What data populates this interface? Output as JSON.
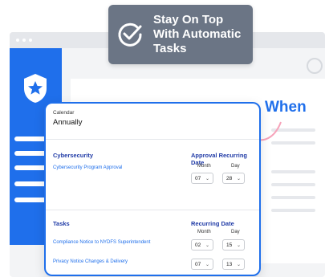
{
  "tooltip": {
    "lines": [
      "Stay On Top",
      "With Automatic",
      "Tasks"
    ]
  },
  "when_label": "When",
  "card": {
    "calendar_label": "Calendar",
    "calendar_value": "Annually",
    "cyber": {
      "title": "Cybersecurity",
      "item": "Cybersecurity Program Approval",
      "column_title": "Approval Recurring Date",
      "month_label": "Month",
      "day_label": "Day",
      "month_value": "07",
      "day_value": "28"
    },
    "tasks": {
      "title": "Tasks",
      "column_title": "Recurring Date",
      "month_label": "Month",
      "day_label": "Day",
      "rows": [
        {
          "label": "Compliance Notice to NYDFS Superintendent",
          "month": "02",
          "day": "15"
        },
        {
          "label": "Privacy Notice Changes & Delivery",
          "month": "07",
          "day": "13"
        }
      ]
    }
  },
  "colors": {
    "brand_blue": "#1f6feb",
    "tooltip_bg": "#6b7585",
    "accent_pink": "#f04f7d"
  },
  "icons": {
    "tooltip": "check-circle-icon",
    "sidebar": "shield-star-icon"
  }
}
